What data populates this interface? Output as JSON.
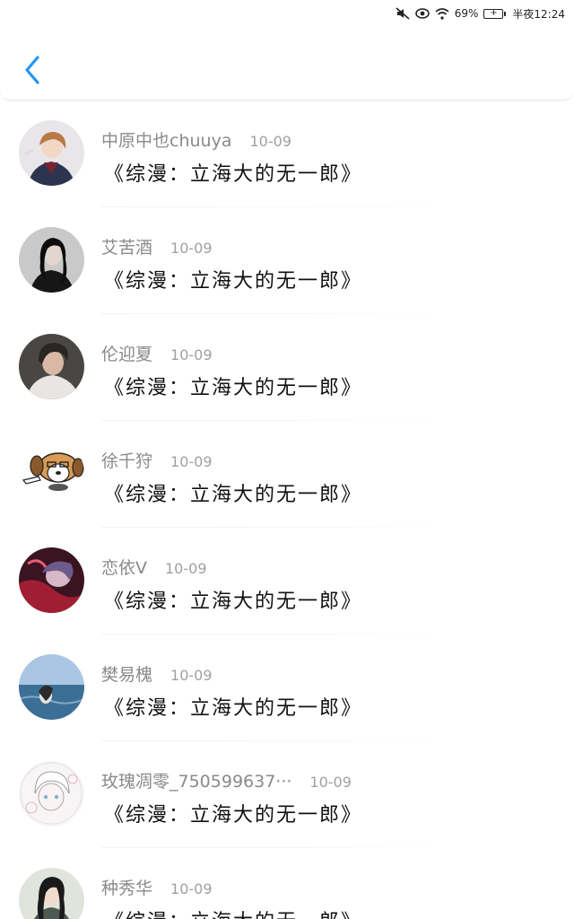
{
  "status_bar": {
    "battery": "69%",
    "time": "半夜12:24",
    "icons": [
      "mute-icon",
      "eye-icon",
      "wifi-icon",
      "battery-icon"
    ]
  },
  "header": {
    "back_icon": "chevron-left-icon",
    "accent_color": "#2196F3"
  },
  "items": [
    {
      "user": "中原中也chuuya",
      "date": "10-09",
      "title": "《综漫：立海大的无一郎》"
    },
    {
      "user": "艾苦酒",
      "date": "10-09",
      "title": "《综漫：立海大的无一郎》"
    },
    {
      "user": "伦迎夏",
      "date": "10-09",
      "title": "《综漫：立海大的无一郎》"
    },
    {
      "user": "徐千狩",
      "date": "10-09",
      "title": "《综漫：立海大的无一郎》"
    },
    {
      "user": "恋依V",
      "date": "10-09",
      "title": "《综漫：立海大的无一郎》"
    },
    {
      "user": "樊易槐",
      "date": "10-09",
      "title": "《综漫：立海大的无一郎》"
    },
    {
      "user": "玫瑰凋零_750599637···",
      "date": "10-09",
      "title": "《综漫：立海大的无一郎》"
    },
    {
      "user": "种秀华",
      "date": "10-09",
      "title": "《综漫：立海大的无一郎》"
    }
  ]
}
